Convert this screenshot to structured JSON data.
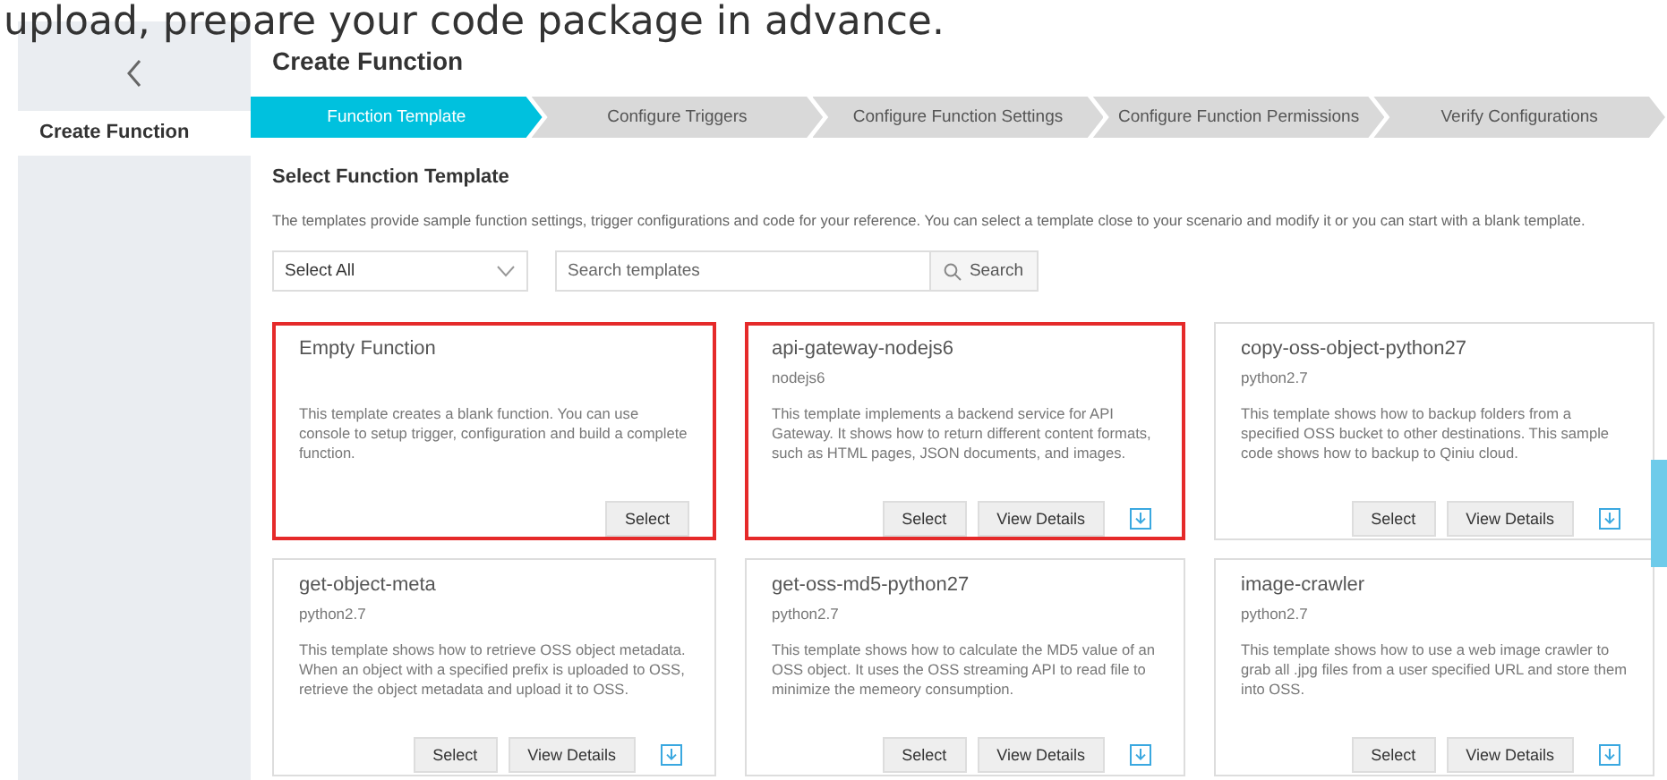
{
  "caption": "upload, prepare your code package in advance.",
  "sidebar": {
    "items": [
      {
        "label": "Create Function",
        "selected": true
      }
    ]
  },
  "page_title": "Create Function",
  "steps": [
    {
      "label": "Function Template",
      "selected": true
    },
    {
      "label": "Configure Triggers",
      "selected": false
    },
    {
      "label": "Configure Function Settings",
      "selected": false
    },
    {
      "label": "Configure Function Permissions",
      "selected": false
    },
    {
      "label": "Verify Configurations",
      "selected": false
    }
  ],
  "section_title": "Select Function Template",
  "description": "The templates provide sample function settings, trigger configurations and code for your reference. You can select a template close to your scenario and modify it or you can start with a blank template.",
  "filter": {
    "value": "Select All"
  },
  "search": {
    "placeholder": "Search templates",
    "button": "Search"
  },
  "templates": [
    {
      "name": "Empty Function",
      "description": "This template creates a blank function. You can use console to setup trigger, configuration and build a complete function.",
      "highlighted": true,
      "buttons": [
        "Select"
      ],
      "download": false
    },
    {
      "name": "api-gateway-nodejs6",
      "runtime": "nodejs6",
      "description": "This template implements a backend service for API Gateway. It shows how to return different content formats, such as HTML pages, JSON documents, and images.",
      "highlighted": true,
      "buttons": [
        "Select",
        "View Details"
      ],
      "download": true
    },
    {
      "name": "copy-oss-object-python27",
      "runtime": "python2.7",
      "description": "This template shows how to backup folders from a specified OSS bucket to other destinations. This sample code shows how to backup to Qiniu cloud.",
      "highlighted": false,
      "buttons": [
        "Select",
        "View Details"
      ],
      "download": true
    },
    {
      "name": "get-object-meta",
      "runtime": "python2.7",
      "description": "This template shows how to retrieve OSS object metadata. When an object with a specified prefix is uploaded to OSS, retrieve the object metadata and upload it to OSS.",
      "highlighted": false,
      "buttons": [
        "Select",
        "View Details"
      ],
      "download": true
    },
    {
      "name": "get-oss-md5-python27",
      "runtime": "python2.7",
      "description": "This template shows how to calculate the MD5 value of an OSS object. It uses the OSS streaming API to read file to minimize the memeory consumption.",
      "highlighted": false,
      "buttons": [
        "Select",
        "View Details"
      ],
      "download": true
    },
    {
      "name": "image-crawler",
      "runtime": "python2.7",
      "description": "This template shows how to use a web image crawler to grab all .jpg files from a user specified URL and store them into OSS.",
      "highlighted": false,
      "buttons": [
        "Select",
        "View Details"
      ],
      "download": true
    }
  ]
}
